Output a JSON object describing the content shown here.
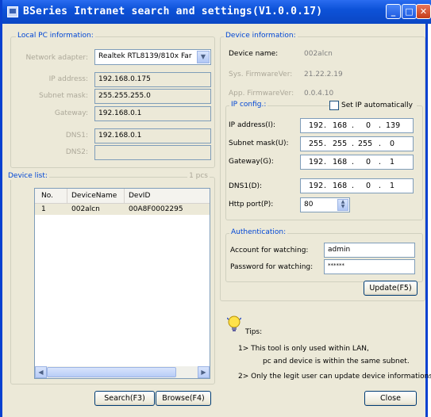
{
  "window": {
    "title": "BSeries Intranet search and settings(V1.0.0.17)"
  },
  "local_pc": {
    "legend": "Local PC information:",
    "network_adapter_label": "Network adapter:",
    "network_adapter_value": "Realtek RTL8139/810x Far",
    "ip_label": "IP address:",
    "ip_value": "192.168.0.175",
    "subnet_label": "Subnet mask:",
    "subnet_value": "255.255.255.0",
    "gateway_label": "Gateway:",
    "gateway_value": "192.168.0.1",
    "dns1_label": "DNS1:",
    "dns1_value": "192.168.0.1",
    "dns2_label": "DNS2:",
    "dns2_value": ""
  },
  "device_list": {
    "legend": "Device list:",
    "count": "1 pcs",
    "columns": [
      "No.",
      "DeviceName",
      "DevID"
    ],
    "rows": [
      {
        "no": "1",
        "name": "002alcn",
        "id": "00A8F0002295"
      }
    ],
    "search_label": "Search(F3)",
    "browse_label": "Browse(F4)"
  },
  "device_info": {
    "legend": "Device information:",
    "name_label": "Device name:",
    "name_value": "002alcn",
    "sys_fw_label": "Sys. FirmwareVer:",
    "sys_fw_value": "21.22.2.19",
    "app_fw_label": "App. FirmwareVer:",
    "app_fw_value": "0.0.4.10"
  },
  "ip_config": {
    "legend": "IP config.:",
    "auto_label": "Set IP automatically",
    "auto_checked": false,
    "ip_label": "IP address(I):",
    "ip": [
      "192",
      "168",
      "0",
      "139"
    ],
    "subnet_label": "Subnet mask(U):",
    "subnet": [
      "255",
      "255",
      "255",
      "0"
    ],
    "gateway_label": "Gateway(G):",
    "gateway": [
      "192",
      "168",
      "0",
      "1"
    ],
    "dns1_label": "DNS1(D):",
    "dns1": [
      "192",
      "168",
      "0",
      "1"
    ],
    "http_label": "Http port(P):",
    "http_value": "80"
  },
  "auth": {
    "legend": "Authentication:",
    "account_label": "Account for watching:",
    "account_value": "admin",
    "password_label": "Password for watching:",
    "password_value": "******",
    "update_label": "Update(F5)"
  },
  "tips": {
    "title": "Tips:",
    "line1": "1> This tool is only used within LAN,",
    "line2": "pc and device is within the same subnet.",
    "line3": "2> Only the legit user can update  device informations."
  },
  "close_label": "Close",
  "colors": {
    "title_bar": "#0a46c4",
    "legend_text": "#0046d5",
    "selected_row": "#316ac5"
  }
}
